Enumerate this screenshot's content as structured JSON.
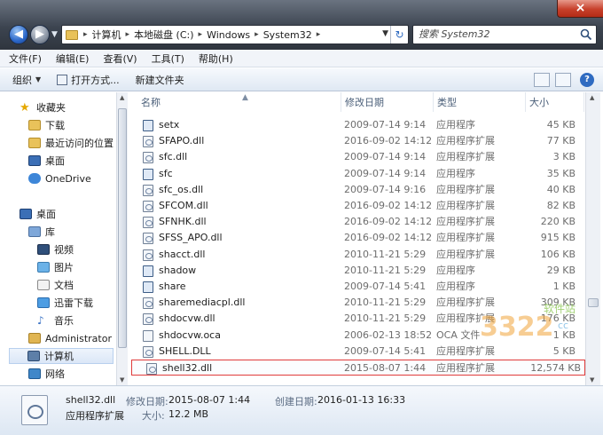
{
  "window": {
    "close_label": "×"
  },
  "nav": {
    "back_glyph": "◀",
    "forward_glyph": "▶"
  },
  "address": {
    "crumbs": [
      "计算机",
      "本地磁盘 (C:)",
      "Windows",
      "System32"
    ],
    "separator": "▸",
    "refresh_glyph": "↻"
  },
  "search": {
    "placeholder": "搜索 System32"
  },
  "menu": {
    "items": [
      "文件(F)",
      "编辑(E)",
      "查看(V)",
      "工具(T)",
      "帮助(H)"
    ]
  },
  "commands": {
    "organize": "组织",
    "open_with": "打开方式...",
    "new_folder": "新建文件夹",
    "help_glyph": "?"
  },
  "navpane": {
    "items": [
      {
        "label": "收藏夹",
        "icon": "star-icon"
      },
      {
        "label": "下载",
        "icon": "download-folder-icon"
      },
      {
        "label": "最近访问的位置",
        "icon": "recent-places-icon"
      },
      {
        "label": "桌面",
        "icon": "desktop-icon"
      },
      {
        "label": "OneDrive",
        "icon": "onedrive-icon"
      },
      {
        "label": "桌面",
        "icon": "desktop-icon"
      },
      {
        "label": "库",
        "icon": "library-icon"
      },
      {
        "label": "视频",
        "icon": "video-icon"
      },
      {
        "label": "图片",
        "icon": "picture-icon"
      },
      {
        "label": "文档",
        "icon": "document-icon"
      },
      {
        "label": "迅雷下载",
        "icon": "thunder-download-icon"
      },
      {
        "label": "音乐",
        "icon": "music-icon"
      },
      {
        "label": "Administrator",
        "icon": "user-folder-icon"
      },
      {
        "label": "计算机",
        "icon": "computer-icon"
      },
      {
        "label": "网络",
        "icon": "network-icon"
      }
    ]
  },
  "columns": {
    "name": "名称",
    "date": "修改日期",
    "type": "类型",
    "size": "大小"
  },
  "files": [
    {
      "name": "setx",
      "date": "2009-07-14 9:14",
      "type": "应用程序",
      "size": "45 KB",
      "kind": "exe"
    },
    {
      "name": "SFAPO.dll",
      "date": "2016-09-02 14:12",
      "type": "应用程序扩展",
      "size": "77 KB",
      "kind": "dll"
    },
    {
      "name": "sfc.dll",
      "date": "2009-07-14 9:14",
      "type": "应用程序扩展",
      "size": "3 KB",
      "kind": "dll"
    },
    {
      "name": "sfc",
      "date": "2009-07-14 9:14",
      "type": "应用程序",
      "size": "35 KB",
      "kind": "exe"
    },
    {
      "name": "sfc_os.dll",
      "date": "2009-07-14 9:16",
      "type": "应用程序扩展",
      "size": "40 KB",
      "kind": "dll"
    },
    {
      "name": "SFCOM.dll",
      "date": "2016-09-02 14:12",
      "type": "应用程序扩展",
      "size": "82 KB",
      "kind": "dll"
    },
    {
      "name": "SFNHK.dll",
      "date": "2016-09-02 14:12",
      "type": "应用程序扩展",
      "size": "220 KB",
      "kind": "dll"
    },
    {
      "name": "SFSS_APO.dll",
      "date": "2016-09-02 14:12",
      "type": "应用程序扩展",
      "size": "915 KB",
      "kind": "dll"
    },
    {
      "name": "shacct.dll",
      "date": "2010-11-21 5:29",
      "type": "应用程序扩展",
      "size": "106 KB",
      "kind": "dll"
    },
    {
      "name": "shadow",
      "date": "2010-11-21 5:29",
      "type": "应用程序",
      "size": "29 KB",
      "kind": "exe"
    },
    {
      "name": "share",
      "date": "2009-07-14 5:41",
      "type": "应用程序",
      "size": "1 KB",
      "kind": "exe"
    },
    {
      "name": "sharemediacpl.dll",
      "date": "2010-11-21 5:29",
      "type": "应用程序扩展",
      "size": "309 KB",
      "kind": "dll"
    },
    {
      "name": "shdocvw.dll",
      "date": "2010-11-21 5:29",
      "type": "应用程序扩展",
      "size": "176 KB",
      "kind": "dll"
    },
    {
      "name": "shdocvw.oca",
      "date": "2006-02-13 18:52",
      "type": "OCA 文件",
      "size": "1 KB",
      "kind": "file"
    },
    {
      "name": "SHELL.DLL",
      "date": "2009-07-14 5:41",
      "type": "应用程序扩展",
      "size": "5 KB",
      "kind": "dll"
    },
    {
      "name": "shell32.dll",
      "date": "2015-08-07 1:44",
      "type": "应用程序扩展",
      "size": "12,574 KB",
      "kind": "dll",
      "selected": true
    }
  ],
  "watermark": {
    "text": "软件站",
    "logo": "3322",
    "sub": "cc"
  },
  "details": {
    "name": "shell32.dll",
    "type": "应用程序扩展",
    "modified_label": "修改日期:",
    "modified_value": "2015-08-07 1:44",
    "created_label": "创建日期:",
    "created_value": "2016-01-13 16:33",
    "size_label": "大小:",
    "size_value": "12.2 MB"
  }
}
